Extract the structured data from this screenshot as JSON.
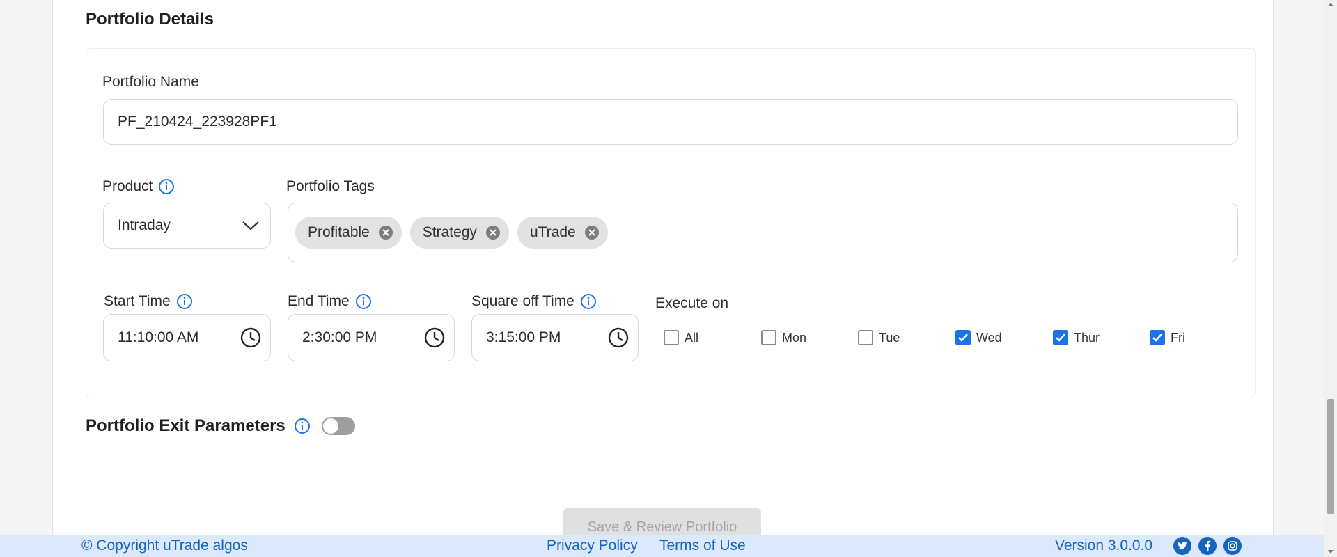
{
  "portfolio_details": {
    "title": "Portfolio Details",
    "name_label": "Portfolio Name",
    "name_value": "PF_210424_223928PF1",
    "product_label": "Product",
    "product_value": "Intraday",
    "tags_label": "Portfolio Tags",
    "tags": [
      "Profitable",
      "Strategy",
      "uTrade"
    ],
    "start_time_label": "Start Time",
    "start_time_value": "11:10:00 AM",
    "end_time_label": "End Time",
    "end_time_value": "2:30:00 PM",
    "square_off_label": "Square off Time",
    "square_off_value": "3:15:00 PM",
    "execute_on_label": "Execute on",
    "days": [
      {
        "label": "All",
        "checked": false
      },
      {
        "label": "Mon",
        "checked": false
      },
      {
        "label": "Tue",
        "checked": false
      },
      {
        "label": "Wed",
        "checked": true
      },
      {
        "label": "Thur",
        "checked": true
      },
      {
        "label": "Fri",
        "checked": true
      }
    ]
  },
  "exit_parameters": {
    "title": "Portfolio Exit Parameters",
    "enabled": false
  },
  "actions": {
    "save_label": "Save & Review Portfolio"
  },
  "footer": {
    "copyright": "© Copyright uTrade algos",
    "privacy": "Privacy Policy",
    "terms": "Terms of Use",
    "version": "Version 3.0.0.0",
    "social": [
      "twitter-icon",
      "facebook-icon",
      "instagram-icon"
    ]
  },
  "colors": {
    "accent": "#1a73e8",
    "footer_bg": "#dbe9fb",
    "footer_text": "#1565c0"
  }
}
